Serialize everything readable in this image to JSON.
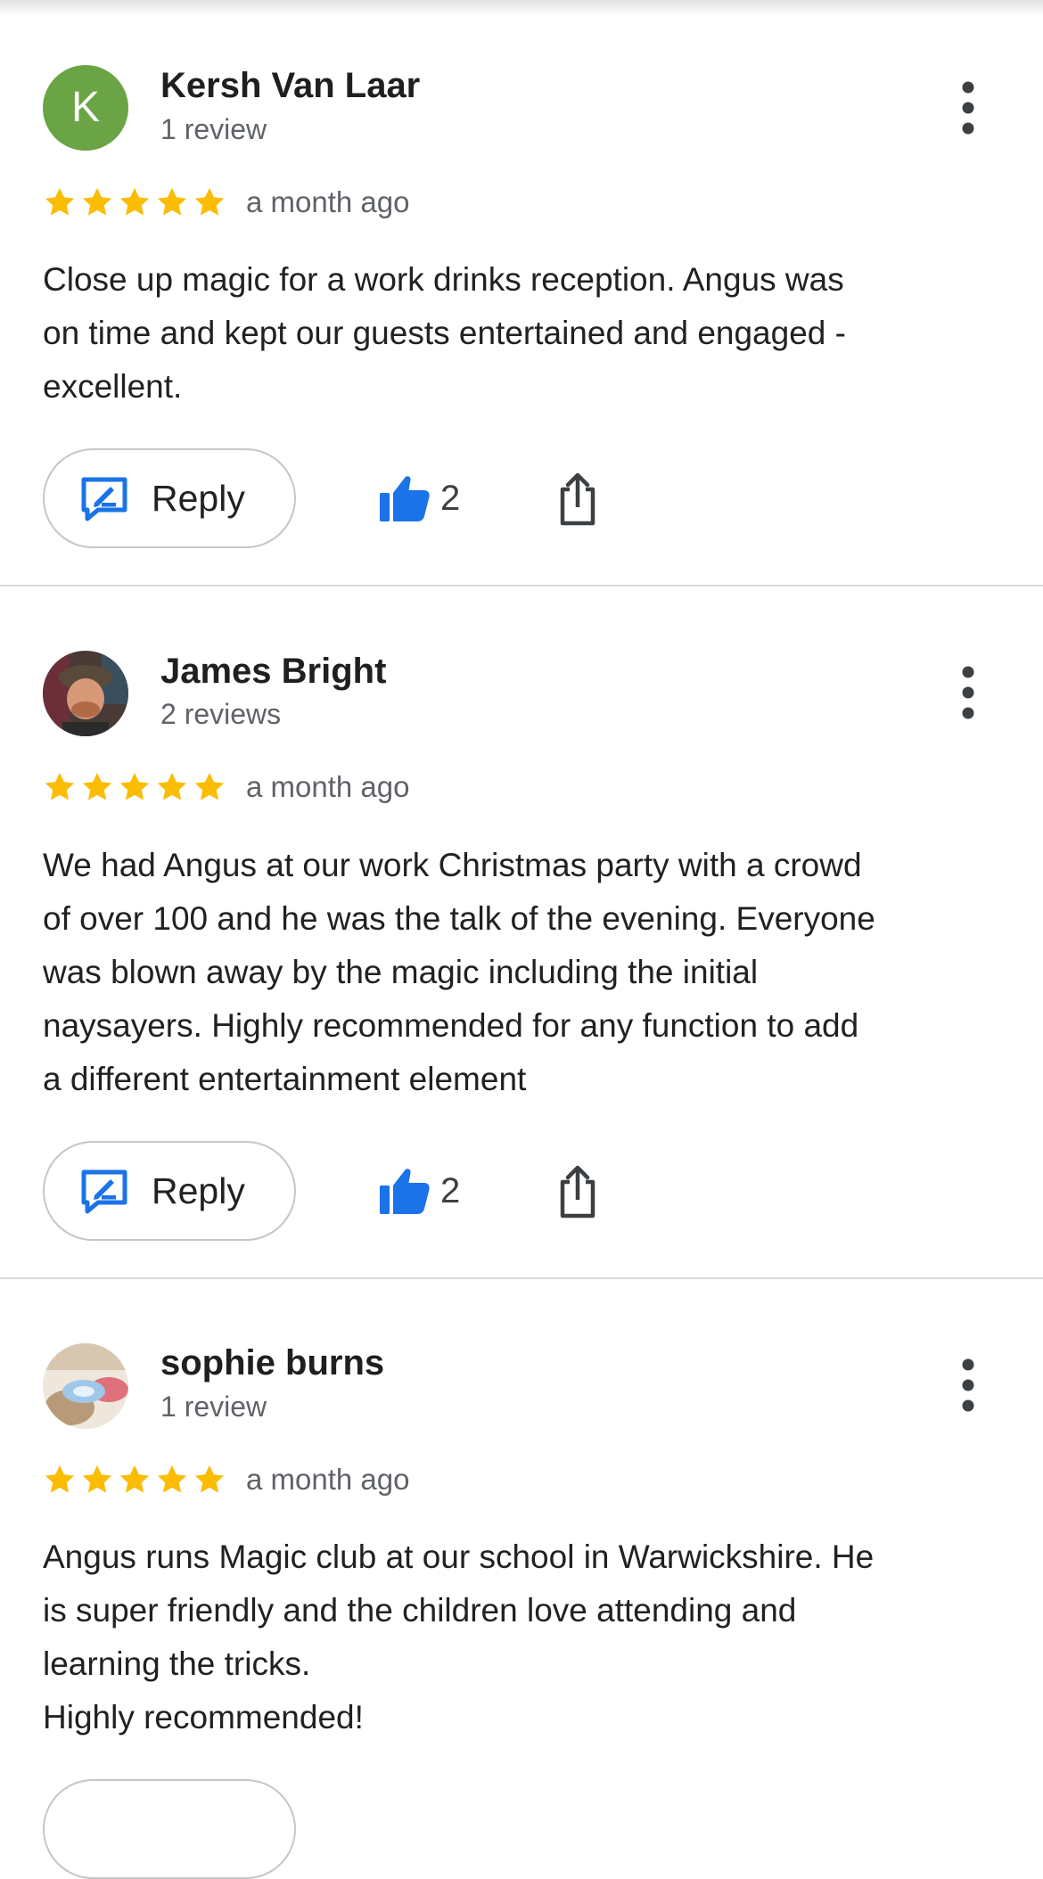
{
  "icons": {
    "more": "more-vert-icon",
    "star": "star-icon",
    "reply": "reply-edit-icon",
    "like": "thumb-up-icon",
    "share": "share-icon"
  },
  "colors": {
    "star": "#fbbc04",
    "like": "#1a73e8",
    "reply_icon": "#1a73e8",
    "avatar_k": "#6aa444"
  },
  "reviews": [
    {
      "avatar_letter": "K",
      "name": "Kersh Van Laar",
      "review_count": "1 review",
      "rating": 5,
      "date": "a month ago",
      "text": "Close up magic for a work drinks reception. Angus was\non time and kept our guests entertained and engaged -\nexcellent.",
      "reply_label": "Reply",
      "likes": "2"
    },
    {
      "name": "James Bright",
      "review_count": "2 reviews",
      "rating": 5,
      "date": "a month ago",
      "text": "We had Angus at our work Christmas party with a crowd\nof over 100 and he was the talk of the evening. Everyone\nwas blown away by the magic including the initial\nnaysayers. Highly recommended for any function to add\na different entertainment element",
      "reply_label": "Reply",
      "likes": "2"
    },
    {
      "name": "sophie burns",
      "review_count": "1 review",
      "rating": 5,
      "date": "a month ago",
      "text": "Angus runs Magic club at our school in Warwickshire. He\nis super friendly and the children love attending and\nlearning the tricks.\nHighly recommended!"
    }
  ]
}
